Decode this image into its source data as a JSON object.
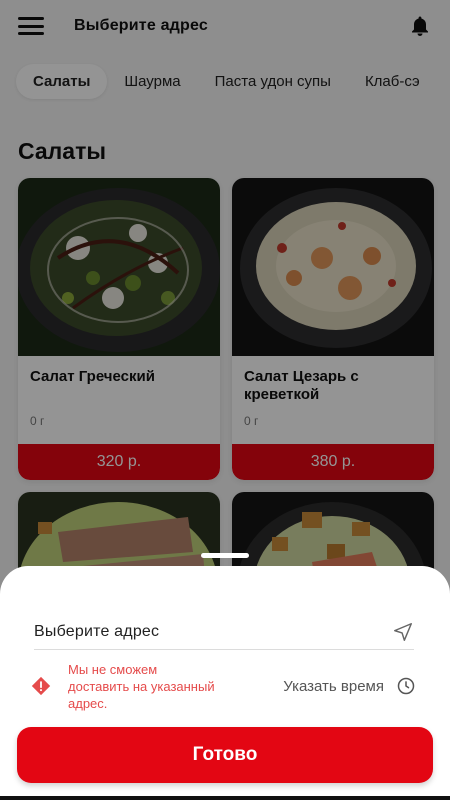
{
  "header": {
    "title": "Выберите адрес",
    "menu_icon": "hamburger-menu-icon",
    "bell_icon": "bell-icon"
  },
  "tabs": [
    {
      "label": "Салаты",
      "active": true
    },
    {
      "label": "Шаурма",
      "active": false
    },
    {
      "label": "Паста удон супы",
      "active": false
    },
    {
      "label": "Клаб-сэ",
      "active": false
    }
  ],
  "section": {
    "title": "Салаты"
  },
  "products": [
    {
      "name": "Салат Греческий",
      "weight": "0 г",
      "price": "320 р."
    },
    {
      "name": "Салат Цезарь с креветкой",
      "weight": "0 г",
      "price": "380 р."
    }
  ],
  "sheet": {
    "address_placeholder": "Выберите адрес",
    "warning": "Мы не сможем доставить на указанный адрес.",
    "time_label": "Указать время",
    "done_label": "Готово"
  },
  "colors": {
    "accent": "#e30613",
    "warning": "#e54b4b"
  }
}
